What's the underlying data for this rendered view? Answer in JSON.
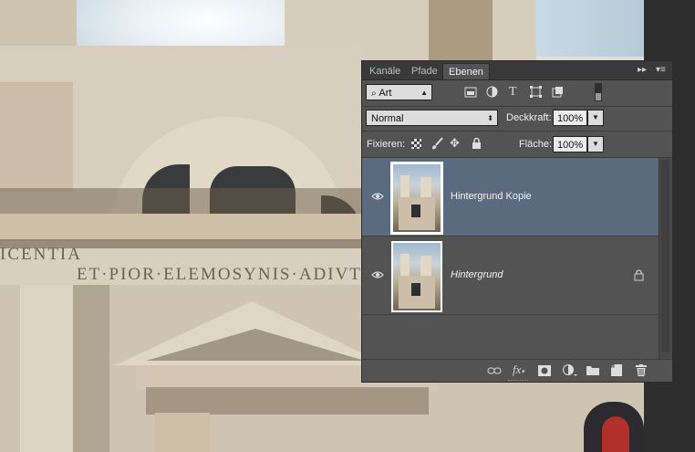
{
  "tabs": [
    {
      "label": "Kanäle",
      "active": false
    },
    {
      "label": "Pfade",
      "active": false
    },
    {
      "label": "Ebenen",
      "active": true
    }
  ],
  "filter": {
    "kind_label": "Art"
  },
  "blend": {
    "mode": "Normal",
    "opacity_label": "Deckkraft:",
    "opacity_value": "100%"
  },
  "lock": {
    "label": "Fixieren:",
    "fill_label": "Fläche:",
    "fill_value": "100%"
  },
  "layers": [
    {
      "name": "Hintergrund Kopie",
      "selected": true,
      "italic": false,
      "locked": false
    },
    {
      "name": "Hintergrund",
      "selected": false,
      "italic": true,
      "locked": true
    }
  ],
  "photo": {
    "inscription_1": "ICENTIA",
    "inscription_2": "ET·PIOR·ELEMOSYNIS·ADIVTA"
  },
  "icons": {
    "panel_menu": "panel-menu-icon",
    "collapse": "double-arrow-icon",
    "search": "search-icon",
    "filter_pixel": "image-filter-icon",
    "filter_adjust": "adjustment-filter-icon",
    "filter_type": "type-filter-icon",
    "filter_shape": "shape-filter-icon",
    "filter_smart": "smart-object-filter-icon",
    "filter_toggle": "filter-toggle-icon",
    "eye": "eye-icon",
    "lock": "lock-icon",
    "link": "link-icon",
    "fx": "fx-icon",
    "mask": "mask-icon",
    "adjustment": "new-adjustment-icon",
    "group": "folder-icon",
    "new_layer": "new-layer-icon",
    "delete": "trash-icon"
  },
  "colors": {
    "panel_bg": "#535353",
    "selected_layer": "#5a6b80",
    "tab_bar": "#3a3a3a"
  }
}
